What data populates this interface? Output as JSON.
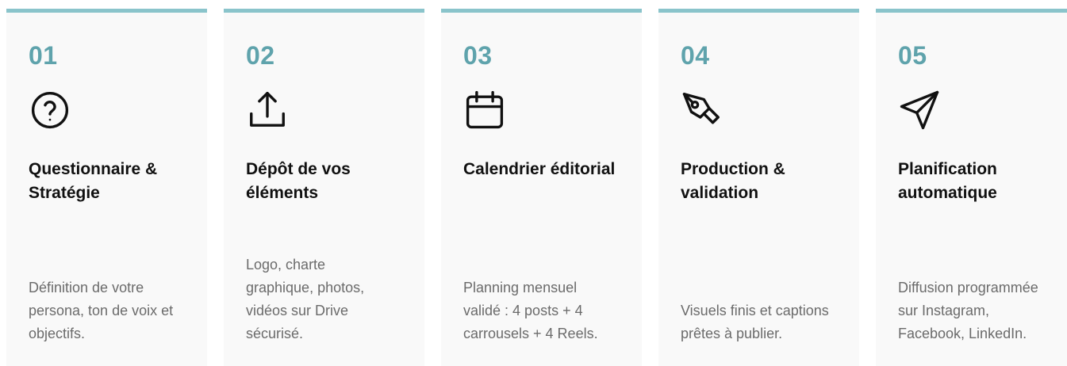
{
  "steps": [
    {
      "number": "01",
      "icon": "help-circle-icon",
      "title": "Questionnaire & Stratégie",
      "description": "Définition de votre persona, ton de voix et objectifs."
    },
    {
      "number": "02",
      "icon": "upload-icon",
      "title": "Dépôt de vos éléments",
      "description": "Logo, charte graphique, photos, vidéos sur Drive sécurisé."
    },
    {
      "number": "03",
      "icon": "calendar-icon",
      "title": "Calendrier éditorial",
      "description": "Planning mensuel validé : 4 posts + 4 carrousels + 4 Reels."
    },
    {
      "number": "04",
      "icon": "pen-tool-icon",
      "title": "Production & validation",
      "description": "Visuels finis et captions prêtes à publier."
    },
    {
      "number": "05",
      "icon": "send-icon",
      "title": "Planification automatique",
      "description": "Diffusion programmée sur Instagram, Facebook, LinkedIn."
    }
  ],
  "colors": {
    "accent": "#8ac4cb",
    "number": "#5fa3ac",
    "card_background": "#f9f9f9",
    "title": "#111111",
    "description": "#6b6b6b"
  }
}
